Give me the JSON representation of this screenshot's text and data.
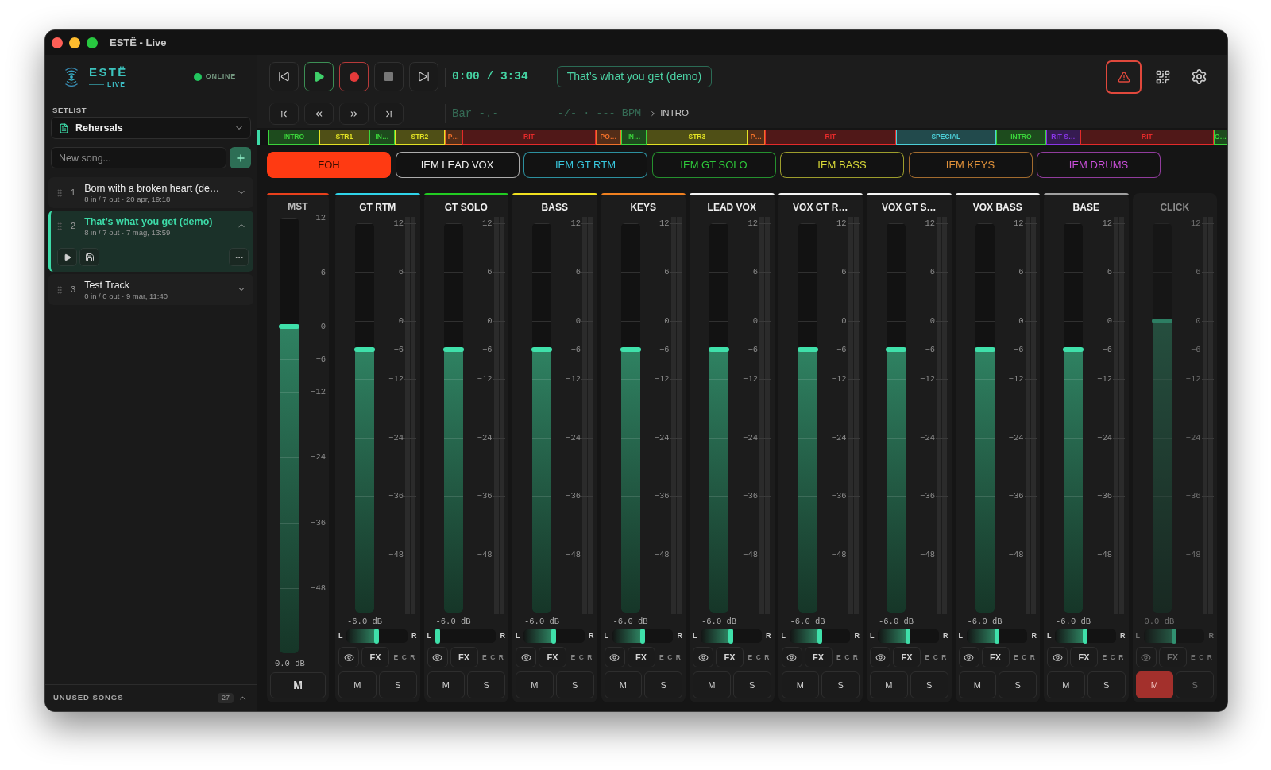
{
  "window": {
    "title": "ESTË - Live"
  },
  "sidebar": {
    "logo": {
      "name": "ESTË",
      "subtitle": "LIVE"
    },
    "status": {
      "label": "ONLINE",
      "online": true
    },
    "setlist": {
      "label": "SETLIST",
      "value": "Rehersals"
    },
    "new_song": {
      "placeholder": "New song..."
    },
    "songs": [
      {
        "number": "1",
        "title": "Born with a broken heart (de…",
        "meta": "8 in / 7 out · 20 apr, 19:18",
        "selected": false,
        "expanded": false
      },
      {
        "number": "2",
        "title": "That’s what you get (demo)",
        "meta": "8 in / 7 out · 7 mag, 13:59",
        "selected": true,
        "expanded": true
      },
      {
        "number": "3",
        "title": "Test Track",
        "meta": "0 in / 0 out · 9 mar, 11:40",
        "selected": false,
        "expanded": false
      }
    ],
    "footer": {
      "label": "UNUSED SONGS",
      "count": "27"
    }
  },
  "transport": {
    "time": "0:00 / 3:34",
    "song_title": "That’s what you get (demo)",
    "bar": "Bar -.-",
    "tempo": "-/- · --- BPM",
    "section": "INTRO"
  },
  "timeline": {
    "sections": [
      {
        "label": "INTRO",
        "color": "#3bd43b"
      },
      {
        "label": "STR1",
        "color": "#e2e224"
      },
      {
        "label": "IN…",
        "color": "#3bd43b"
      },
      {
        "label": "STR2",
        "color": "#e2e224"
      },
      {
        "label": "P…",
        "color": "#f0702a"
      },
      {
        "label": "RIT",
        "color": "#e42a2a"
      },
      {
        "label": "PO…",
        "color": "#f0702a"
      },
      {
        "label": "IN…",
        "color": "#3bd43b"
      },
      {
        "label": "STR3",
        "color": "#e2e224"
      },
      {
        "label": "P…",
        "color": "#f0702a"
      },
      {
        "label": "RIT",
        "color": "#e42a2a"
      },
      {
        "label": "SPECIAL",
        "color": "#4ccfd8"
      },
      {
        "label": "INTRO",
        "color": "#3bd43b"
      },
      {
        "label": "RIT S…",
        "color": "#8a36e8"
      },
      {
        "label": "RIT",
        "color": "#e42a2a"
      },
      {
        "label": "O…",
        "color": "#3bd43b"
      }
    ]
  },
  "outputs": [
    {
      "label": "FOH",
      "color": "#ff3a12",
      "selected": true
    },
    {
      "label": "IEM LEAD VOX",
      "color": "#eeeeee",
      "selected": false
    },
    {
      "label": "IEM GT RTM",
      "color": "#38c6dc",
      "selected": false
    },
    {
      "label": "IEM GT SOLO",
      "color": "#2ec73a",
      "selected": false
    },
    {
      "label": "IEM BASS",
      "color": "#d8d838",
      "selected": false
    },
    {
      "label": "IEM KEYS",
      "color": "#e0913a",
      "selected": false
    },
    {
      "label": "IEM DRUMS",
      "color": "#c84fd8",
      "selected": false
    }
  ],
  "master": {
    "name": "MST",
    "color": "#e8401c",
    "level": 0.75,
    "reading": "0.0 dB",
    "scale": [
      "12",
      "6",
      "0",
      "−6",
      "−12",
      "−24",
      "−36",
      "−48"
    ],
    "mute": {
      "label": "M",
      "on": false
    }
  },
  "channels": [
    {
      "name": "GT RTM",
      "color": "#2fd4ea",
      "inactive": false,
      "level": 0.675,
      "reading": "-6.0 dB",
      "scale": [
        "12",
        "6",
        "0",
        "−6",
        "−12",
        "−24",
        "−36",
        "−48"
      ],
      "pan": {
        "left": "L",
        "right": "R",
        "level": 0.5
      },
      "fx": "FX",
      "routes": [
        "E",
        "C",
        "R"
      ],
      "mute": {
        "label": "M",
        "on": false
      },
      "solo": {
        "label": "S",
        "on": false
      }
    },
    {
      "name": "GT SOLO",
      "color": "#22cc22",
      "inactive": false,
      "level": 0.675,
      "reading": "-6.0 dB",
      "scale": [
        "12",
        "6",
        "0",
        "−6",
        "−12",
        "−24",
        "−36",
        "−48"
      ],
      "pan": {
        "left": "L",
        "right": "R",
        "level": 0
      },
      "fx": "FX",
      "routes": [
        "E",
        "C",
        "R"
      ],
      "mute": {
        "label": "M",
        "on": false
      },
      "solo": {
        "label": "S",
        "on": false
      }
    },
    {
      "name": "BASS",
      "color": "#f0e020",
      "inactive": false,
      "level": 0.675,
      "reading": "-6.0 dB",
      "scale": [
        "12",
        "6",
        "0",
        "−6",
        "−12",
        "−24",
        "−36",
        "−48"
      ],
      "pan": {
        "left": "L",
        "right": "R",
        "level": 0.5
      },
      "fx": "FX",
      "routes": [
        "E",
        "C",
        "R"
      ],
      "mute": {
        "label": "M",
        "on": false
      },
      "solo": {
        "label": "S",
        "on": false
      }
    },
    {
      "name": "KEYS",
      "color": "#f08020",
      "inactive": false,
      "level": 0.675,
      "reading": "-6.0 dB",
      "scale": [
        "12",
        "6",
        "0",
        "−6",
        "−12",
        "−24",
        "−36",
        "−48"
      ],
      "pan": {
        "left": "L",
        "right": "R",
        "level": 0.5
      },
      "fx": "FX",
      "routes": [
        "E",
        "C",
        "R"
      ],
      "mute": {
        "label": "M",
        "on": false
      },
      "solo": {
        "label": "S",
        "on": false
      }
    },
    {
      "name": "LEAD VOX",
      "color": "#f5f5f5",
      "inactive": false,
      "level": 0.675,
      "reading": "-6.0 dB",
      "scale": [
        "12",
        "6",
        "0",
        "−6",
        "−12",
        "−24",
        "−36",
        "−48"
      ],
      "pan": {
        "left": "L",
        "right": "R",
        "level": 0.5
      },
      "fx": "FX",
      "routes": [
        "E",
        "C",
        "R"
      ],
      "mute": {
        "label": "M",
        "on": false
      },
      "solo": {
        "label": "S",
        "on": false
      }
    },
    {
      "name": "VOX GT R…",
      "color": "#f5f5f5",
      "inactive": false,
      "level": 0.675,
      "reading": "-6.0 dB",
      "scale": [
        "12",
        "6",
        "0",
        "−6",
        "−12",
        "−24",
        "−36",
        "−48"
      ],
      "pan": {
        "left": "L",
        "right": "R",
        "level": 0.5
      },
      "fx": "FX",
      "routes": [
        "E",
        "C",
        "R"
      ],
      "mute": {
        "label": "M",
        "on": false
      },
      "solo": {
        "label": "S",
        "on": false
      }
    },
    {
      "name": "VOX GT S…",
      "color": "#f5f5f5",
      "inactive": false,
      "level": 0.675,
      "reading": "-6.0 dB",
      "scale": [
        "12",
        "6",
        "0",
        "−6",
        "−12",
        "−24",
        "−36",
        "−48"
      ],
      "pan": {
        "left": "L",
        "right": "R",
        "level": 0.5
      },
      "fx": "FX",
      "routes": [
        "E",
        "C",
        "R"
      ],
      "mute": {
        "label": "M",
        "on": false
      },
      "solo": {
        "label": "S",
        "on": false
      }
    },
    {
      "name": "VOX BASS",
      "color": "#f5f5f5",
      "inactive": false,
      "level": 0.675,
      "reading": "-6.0 dB",
      "scale": [
        "12",
        "6",
        "0",
        "−6",
        "−12",
        "−24",
        "−36",
        "−48"
      ],
      "pan": {
        "left": "L",
        "right": "R",
        "level": 0.5
      },
      "fx": "FX",
      "routes": [
        "E",
        "C",
        "R"
      ],
      "mute": {
        "label": "M",
        "on": false
      },
      "solo": {
        "label": "S",
        "on": false
      }
    },
    {
      "name": "BASE",
      "color": "#a0a0a0",
      "inactive": false,
      "level": 0.675,
      "reading": "-6.0 dB",
      "scale": [
        "12",
        "6",
        "0",
        "−6",
        "−12",
        "−24",
        "−36",
        "−48"
      ],
      "pan": {
        "left": "L",
        "right": "R",
        "level": 0.5
      },
      "fx": "FX",
      "routes": [
        "E",
        "C",
        "R"
      ],
      "mute": {
        "label": "M",
        "on": false
      },
      "solo": {
        "label": "S",
        "on": false
      }
    },
    {
      "name": "CLICK",
      "inactive": true,
      "level": 0.75,
      "reading": "0.0 dB",
      "scale": [
        "12",
        "6",
        "0",
        "−6",
        "−12",
        "−24",
        "−36",
        "−48"
      ],
      "pan": {
        "left": "L",
        "right": "R",
        "level": 0.5
      },
      "fx": "FX",
      "routes": [
        "E",
        "C",
        "R"
      ],
      "mute": {
        "label": "M",
        "on": true
      },
      "solo": {
        "label": "S",
        "on": false
      }
    }
  ]
}
